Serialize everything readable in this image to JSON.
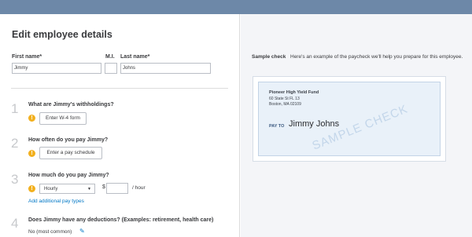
{
  "form": {
    "title": "Edit employee details",
    "first_name_label": "First name*",
    "first_name_value": "Jimmy",
    "mi_label": "M.I.",
    "mi_value": "",
    "last_name_label": "Last name*",
    "last_name_value": "Johns"
  },
  "steps": [
    {
      "num": "1",
      "question": "What are Jimmy's withholdings?",
      "button": "Enter W-4 form"
    },
    {
      "num": "2",
      "question": "How often do you pay Jimmy?",
      "button": "Enter a pay schedule"
    },
    {
      "num": "3",
      "question": "How much do you pay Jimmy?",
      "pay_type": "Hourly",
      "currency": "$",
      "rate_value": "",
      "per_unit": "/ hour",
      "add_link": "Add additional pay types"
    },
    {
      "num": "4",
      "question": "Does Jimmy have any deductions? (Examples: retirement, health care)",
      "value": "No (most common)"
    }
  ],
  "sample_check": {
    "label": "Sample check",
    "description": "Here's an example of the paycheck we'll help you prepare for this employee.",
    "payer_name": "Pioneer High Yield Fund",
    "payer_address_1": "60 State St FL 13",
    "payer_address_2": "Boston, MA 02109",
    "pay_to_label": "PAY TO",
    "payee": "Jimmy Johns",
    "watermark": "SAMPLE CHECK"
  },
  "colors": {
    "topbar": "#6d88a8",
    "link": "#0077c5",
    "warning": "#f2b01e",
    "check_background": "#e9f1f9"
  },
  "icons": {
    "warning": "warning-icon",
    "dropdown": "chevron-down-icon",
    "edit": "pencil-icon"
  }
}
